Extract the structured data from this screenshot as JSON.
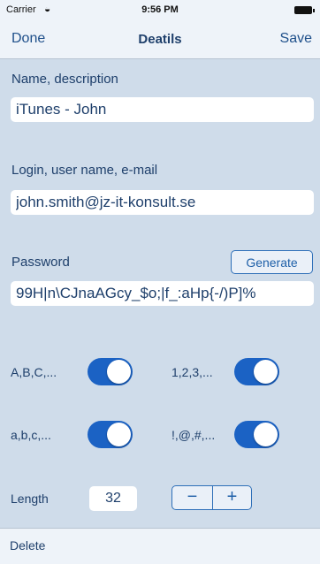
{
  "status_bar": {
    "carrier": "Carrier",
    "wifi_icon": "◒",
    "time": "9:56 PM"
  },
  "nav": {
    "done": "Done",
    "title": "Deatils",
    "save": "Save"
  },
  "fields": {
    "name_label": "Name, description",
    "name_value": "iTunes - John",
    "login_label": "Login, user name, e-mail",
    "login_value": "john.smith@jz-it-konsult.se",
    "password_label": "Password",
    "generate_label": "Generate",
    "password_value": "99H|n\\CJnaAGcy_$o;|f_:aHp{-/)P]%"
  },
  "toggles": [
    {
      "label": "A,B,C,...",
      "on": true
    },
    {
      "label": "1,2,3,...",
      "on": true
    },
    {
      "label": "a,b,c,...",
      "on": true
    },
    {
      "label": "!,@,#,...",
      "on": true
    }
  ],
  "length": {
    "label": "Length",
    "value": "32",
    "minus": "−",
    "plus": "+"
  },
  "bottom": {
    "delete": "Delete"
  },
  "colors": {
    "background": "#cfdcea",
    "accent": "#1b62c4",
    "text": "#1e3f6b"
  }
}
